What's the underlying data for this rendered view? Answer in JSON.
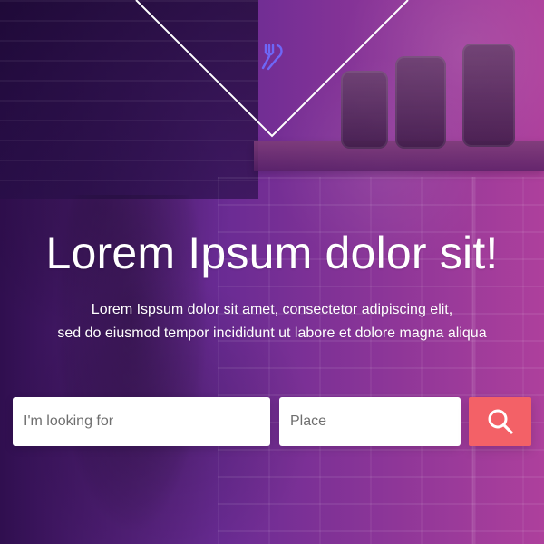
{
  "hero": {
    "title": "Lorem Ipsum dolor sit!",
    "subtitle_line_1": "Lorem Ispsum dolor sit amet, consectetor adipiscing elit,",
    "subtitle_line_2": "sed do eiusmod tempor incididunt ut labore et dolore magna aliqua"
  },
  "search": {
    "what_placeholder": "I'm looking for",
    "place_placeholder": "Place",
    "button_icon": "search-icon"
  },
  "icons": {
    "logo": "fork-knife-icon"
  },
  "colors": {
    "accent": "#f36167",
    "white": "#ffffff",
    "logo": "#6e67f7"
  }
}
